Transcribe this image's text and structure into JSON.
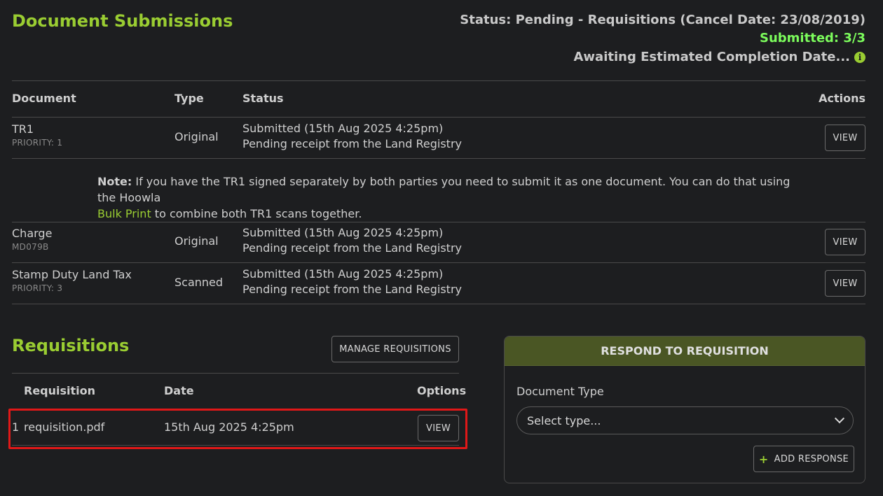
{
  "header": {
    "title": "Document Submissions",
    "status": "Status: Pending - Requisitions (Cancel Date: 23/08/2019)",
    "submitted": "Submitted: 3/3",
    "awaiting": "Awaiting Estimated Completion Date...",
    "info_icon": "i"
  },
  "documents": {
    "columns": {
      "document": "Document",
      "type": "Type",
      "status": "Status",
      "actions": "Actions"
    },
    "rows": [
      {
        "name": "TR1",
        "sub": "PRIORITY: 1",
        "type": "Original",
        "status1": "Submitted (15th Aug 2025 4:25pm)",
        "status2": "Pending receipt from the Land Registry",
        "action": "VIEW"
      },
      {
        "name": "Charge",
        "sub": "MD079B",
        "type": "Original",
        "status1": "Submitted (15th Aug 2025 4:25pm)",
        "status2": "Pending receipt from the Land Registry",
        "action": "VIEW"
      },
      {
        "name": "Stamp Duty Land Tax",
        "sub": "PRIORITY: 3",
        "type": "Scanned",
        "status1": "Submitted (15th Aug 2025 4:25pm)",
        "status2": "Pending receipt from the Land Registry",
        "action": "VIEW"
      }
    ],
    "note": {
      "label": "Note:",
      "text1": " If you have the TR1 signed separately by both parties you need to submit it as one document. You can do that using the Hoowla ",
      "link": "Bulk Print",
      "text2": " to combine both TR1 scans together."
    }
  },
  "requisitions": {
    "title": "Requisitions",
    "manage_label": "MANAGE REQUISITIONS",
    "columns": {
      "requisition": "Requisition",
      "date": "Date",
      "options": "Options"
    },
    "rows": [
      {
        "index": "1",
        "file": "requisition.pdf",
        "date": "15th Aug 2025 4:25pm",
        "action": "VIEW"
      }
    ]
  },
  "respond": {
    "header": "RESPOND TO REQUISITION",
    "doc_type_label": "Document Type",
    "select_value": "Select type...",
    "add_label": "ADD RESPONSE",
    "add_icon": "+"
  }
}
